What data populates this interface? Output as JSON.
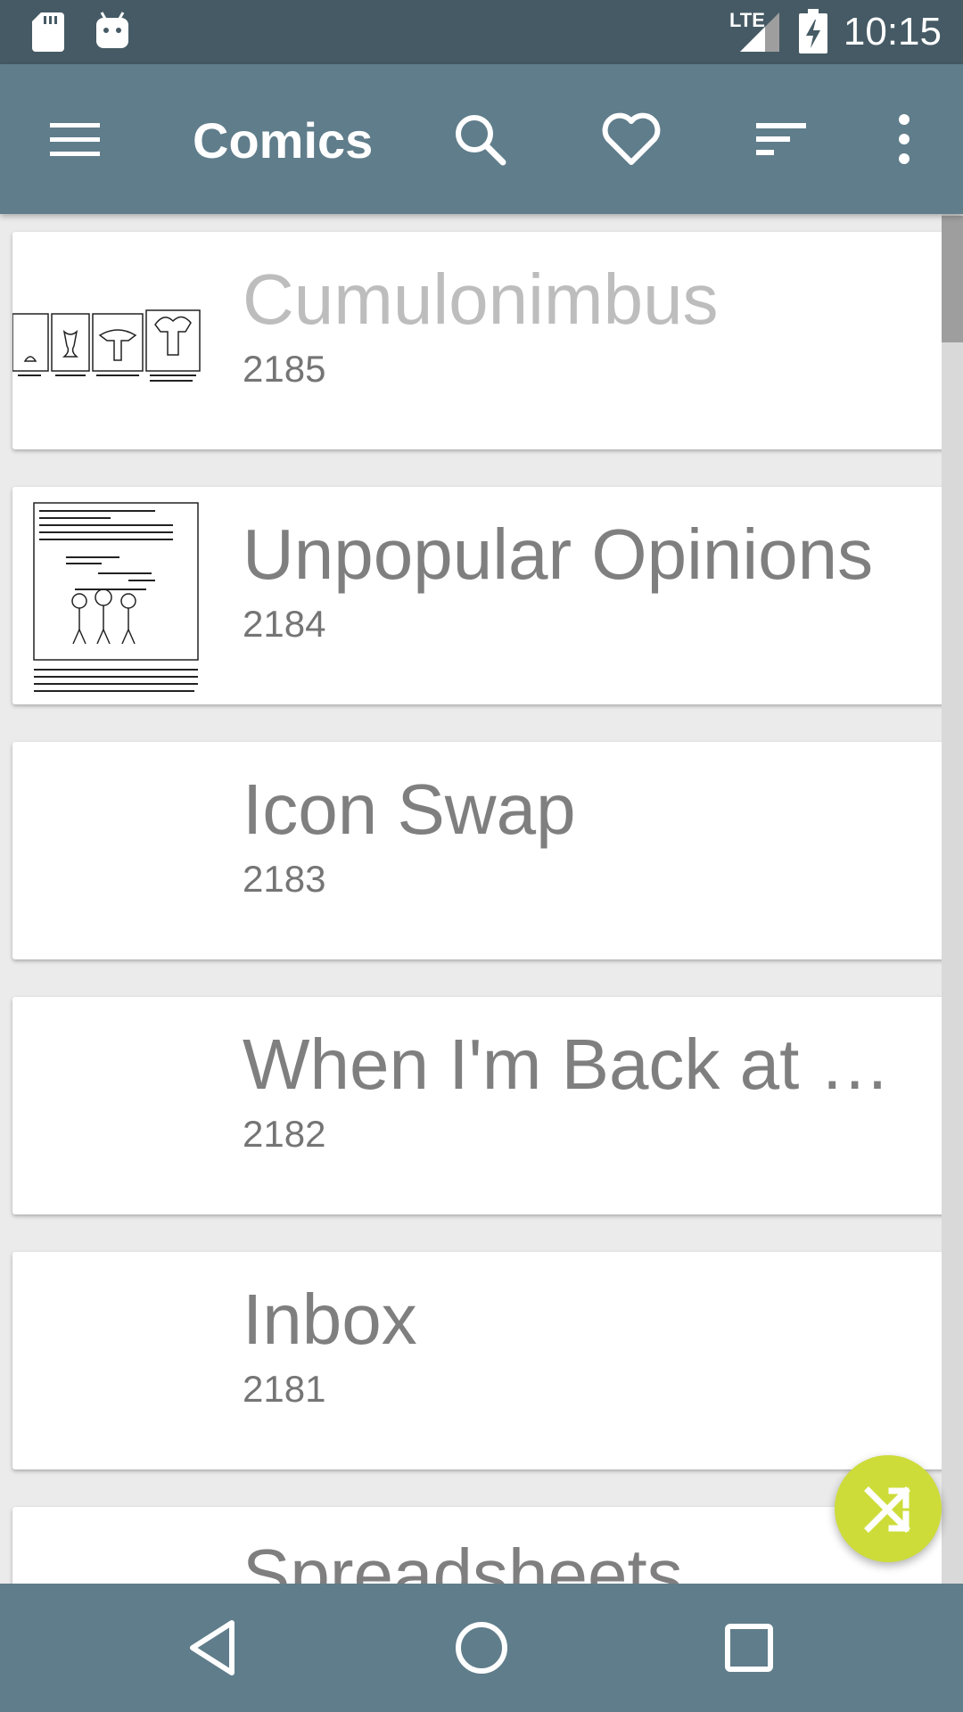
{
  "status_bar": {
    "time": "10:15",
    "network": "LTE",
    "icons": [
      "sd-card-icon",
      "android-icon",
      "signal-icon",
      "battery-charging-icon"
    ]
  },
  "app_bar": {
    "title": "Comics",
    "actions": [
      "menu-icon",
      "search-icon",
      "favorite-icon",
      "sort-icon",
      "more-vert-icon"
    ]
  },
  "comics": [
    {
      "title": "Cumulonimbus",
      "number": "2185"
    },
    {
      "title": "Unpopular Opinions",
      "number": "2184"
    },
    {
      "title": "Icon Swap",
      "number": "2183"
    },
    {
      "title": "When I'm Back at a…",
      "number": "2182"
    },
    {
      "title": "Inbox",
      "number": "2181"
    },
    {
      "title": "Spreadsheets",
      "number": ""
    }
  ],
  "fab": {
    "icon": "shuffle-icon"
  },
  "nav_bar": {
    "buttons": [
      "back-icon",
      "home-icon",
      "recents-icon"
    ]
  },
  "colors": {
    "status_bar": "#455a64",
    "app_bar": "#607d8b",
    "fab": "#cddc39",
    "background": "#ebebeb"
  }
}
